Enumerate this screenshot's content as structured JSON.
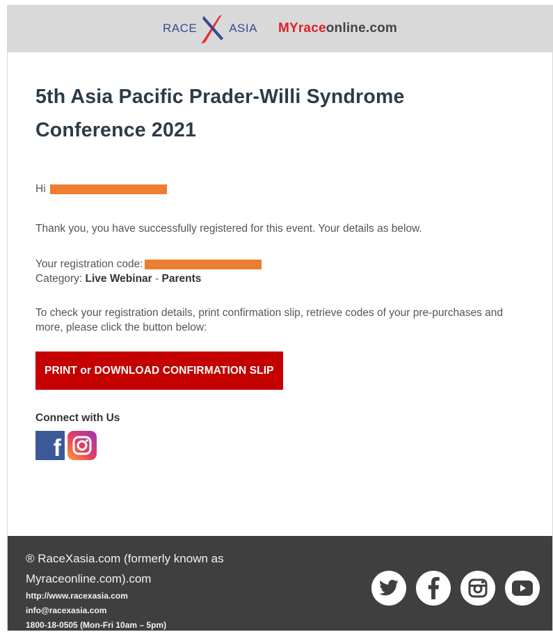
{
  "header": {
    "logo_race": "RACE",
    "logo_asia": "ASIA",
    "logo_my": "MYrace",
    "logo_online": "online.com"
  },
  "email": {
    "title": "5th Asia Pacific Prader-Willi Syndrome Conference 2021",
    "greeting": "Hi",
    "thanks": "Thank you, you have successfully registered for this event. Your details as below.",
    "reg_code_label": "Your registration code:",
    "category_label": "Category: ",
    "category_value": "Live Webinar",
    "category_sep": " - ",
    "category_group": "Parents",
    "instructions": "To check your registration details, print confirmation slip, retrieve codes of your pre-purchases and more, please click the button below:",
    "button_label": "PRINT or DOWNLOAD CONFIRMATION SLIP",
    "connect_heading": "Connect with Us",
    "social_icons": [
      "facebook-icon",
      "instagram-icon"
    ]
  },
  "footer": {
    "company": "® RaceXasia.com (formerly known as Myraceonline.com).com",
    "website": "http://www.racexasia.com",
    "email": "info@racexasia.com",
    "phone": "1800-18-0505 (Mon-Fri 10am – 5pm)",
    "social_icons": [
      "twitter-icon",
      "facebook-icon",
      "instagram-icon",
      "youtube-icon"
    ]
  },
  "colors": {
    "header_bg": "#d9d9d9",
    "button_bg": "#c40000",
    "redaction": "#ed7d31",
    "footer_bg": "#3f3f3f",
    "title": "#2d3b48"
  }
}
